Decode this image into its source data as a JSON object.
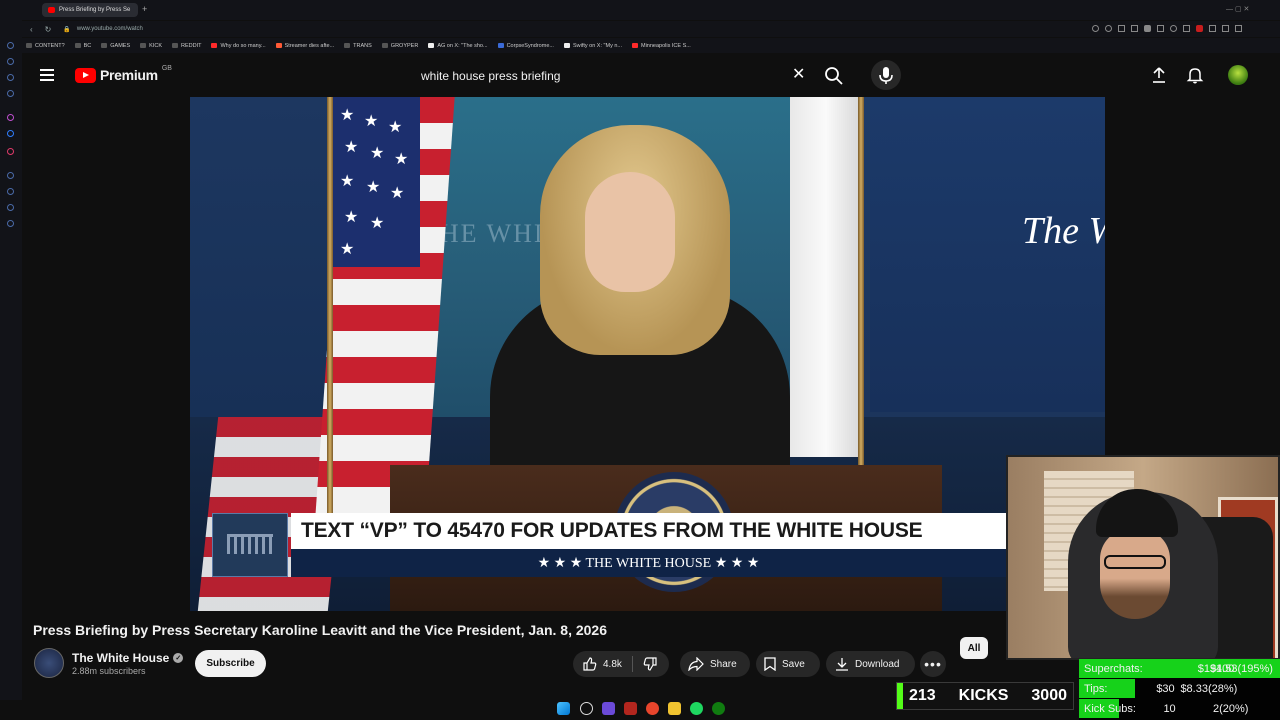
{
  "browser": {
    "tab_title": "Press Briefing by Press Se",
    "url": "www.youtube.com/watch",
    "bookmarks": [
      "CONTENT?",
      "BC",
      "GAMES",
      "KICK",
      "REDDIT",
      "Why do so many...",
      "Streamer dies afte...",
      "TRANS",
      "GROYPER",
      "AG on X: \"The sho...",
      "CorpseSyndrome...",
      "Swifty on X: \"My n...",
      "Minneapolis ICE S..."
    ]
  },
  "header": {
    "logo_text": "Premium",
    "region": "GB",
    "search_value": "white house press briefing",
    "icons": [
      "menu-icon",
      "clear-icon",
      "search-icon",
      "mic-icon",
      "upload-icon",
      "bell-icon",
      "avatar"
    ]
  },
  "video": {
    "right_backdrop_text": "The W",
    "wall_text": "THE WHITE HOUSE",
    "chyron_text": "TEXT “VP” TO 45470 FOR UPDATES FROM THE WHITE HOUSE",
    "chyron_sub": "★ ★ ★  THE WHITE HOUSE  ★ ★ ★"
  },
  "details": {
    "title": "Press Briefing by Press Secretary Karoline Leavitt and the Vice President, Jan. 8, 2026",
    "channel_name": "The White House",
    "subscribers": "2.88m subscribers",
    "subscribe_label": "Subscribe",
    "like_count": "4.8k",
    "share_label": "Share",
    "save_label": "Save",
    "download_label": "Download",
    "more_label": "•••",
    "chip_all": "All"
  },
  "overlay": {
    "superchats": {
      "label": "Superchats:",
      "value": "$194.53(195%)",
      "goal": "$100",
      "fill_percent": 100
    },
    "tips": {
      "label": "Tips:",
      "value": "$8.33(28%)",
      "goal": "$30",
      "fill_percent": 28
    },
    "kick_subs": {
      "label": "Kick Subs:",
      "value": "2(20%)",
      "goal": "10",
      "fill_percent": 20
    },
    "kicks_count": "213",
    "kicks_label": "KICKS",
    "kicks_goal": "3000",
    "colors": {
      "goal_green": "#16d21a",
      "kick_green": "#53fc18"
    }
  },
  "colors": {
    "yt_red": "#ff0000",
    "background": "#0f0f0f",
    "chip_bg": "#272727"
  }
}
